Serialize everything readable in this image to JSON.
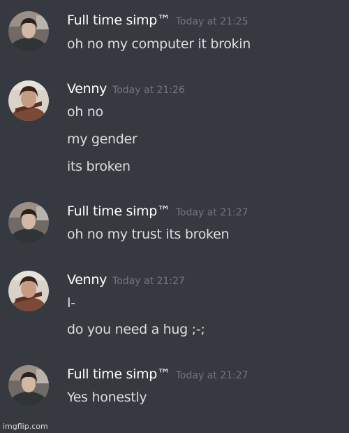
{
  "messages": [
    {
      "author": "Full time simp™",
      "timestamp": "Today at 21:25",
      "avatar": "simp-avatar",
      "lines": [
        "oh no my computer it brokin"
      ]
    },
    {
      "author": "Venny",
      "timestamp": "Today at 21:26",
      "avatar": "venny-avatar",
      "lines": [
        "oh no",
        "my gender",
        "its broken"
      ]
    },
    {
      "author": "Full time simp™",
      "timestamp": "Today at 21:27",
      "avatar": "simp-avatar",
      "lines": [
        "oh no my trust its broken"
      ]
    },
    {
      "author": "Venny",
      "timestamp": "Today at 21:27",
      "avatar": "venny-avatar",
      "lines": [
        "I-",
        "do you need a hug ;-;"
      ]
    },
    {
      "author": "Full time simp™",
      "timestamp": "Today at 21:27",
      "avatar": "simp-avatar",
      "lines": [
        "Yes honestly"
      ]
    }
  ],
  "watermark": "imgflip.com",
  "colors": {
    "background": "#36393f",
    "username": "#ffffff",
    "timestamp": "#72767d",
    "message_text": "#dcddde"
  }
}
